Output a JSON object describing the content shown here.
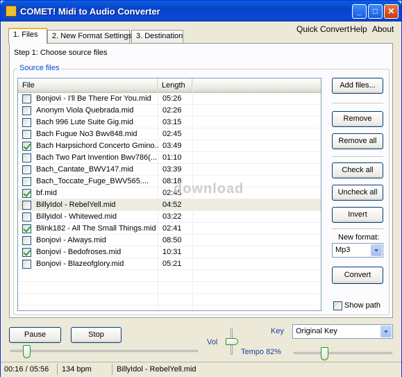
{
  "window": {
    "title": "COMET! Midi to Audio Converter"
  },
  "tabs": [
    {
      "label": "1. Files"
    },
    {
      "label": "2. New Format Settings"
    },
    {
      "label": "3. Destination"
    }
  ],
  "top_links": {
    "quick_convert": "Quick Convert",
    "help": "Help",
    "about": "About"
  },
  "step_text": "Step 1: Choose source files",
  "group_label": "Source files",
  "list": {
    "columns": [
      "File",
      "Length"
    ],
    "rows": [
      {
        "name": "Bonjovi - I'll Be There For You.mid",
        "length": "05:26",
        "checked": false,
        "selected": false
      },
      {
        "name": "Anonym Viola Quebrada.mid",
        "length": "02:26",
        "checked": false,
        "selected": false
      },
      {
        "name": "Bach 996 Lute Suite Gig.mid",
        "length": "03:15",
        "checked": false,
        "selected": false
      },
      {
        "name": "Bach Fugue No3 Bwv848.mid",
        "length": "02:45",
        "checked": false,
        "selected": false
      },
      {
        "name": "Bach Harpsichord Concerto Gmino...",
        "length": "03:49",
        "checked": true,
        "selected": false
      },
      {
        "name": "Bach Two Part Invention Bwv786(...",
        "length": "01:10",
        "checked": false,
        "selected": false
      },
      {
        "name": "Bach_Cantate_BWV147.mid",
        "length": "03:39",
        "checked": false,
        "selected": false
      },
      {
        "name": "Bach_Toccate_Fuge_BWV565....",
        "length": "08:18",
        "checked": false,
        "selected": false
      },
      {
        "name": "bf.mid",
        "length": "02:45",
        "checked": true,
        "selected": false
      },
      {
        "name": "BillyIdol - RebelYell.mid",
        "length": "04:52",
        "checked": false,
        "selected": true
      },
      {
        "name": "Billyidol - Whitewed.mid",
        "length": "03:22",
        "checked": false,
        "selected": false
      },
      {
        "name": "Blink182 - All The Small Things.mid",
        "length": "02:41",
        "checked": true,
        "selected": false
      },
      {
        "name": "Bonjovi - Always.mid",
        "length": "08:50",
        "checked": false,
        "selected": false
      },
      {
        "name": "Bonjovi - Bedofroses.mid",
        "length": "10:31",
        "checked": true,
        "selected": false
      },
      {
        "name": "Bonjovi - Blazeofglory.mid",
        "length": "05:21",
        "checked": false,
        "selected": false
      }
    ]
  },
  "buttons": {
    "add_files": "Add files...",
    "remove": "Remove",
    "remove_all": "Remove all",
    "check_all": "Check all",
    "uncheck_all": "Uncheck all",
    "invert": "Invert",
    "convert": "Convert",
    "pause": "Pause",
    "stop": "Stop"
  },
  "new_format": {
    "label": "New format:",
    "value": "Mp3"
  },
  "show_path": {
    "label": "Show path",
    "checked": false
  },
  "player": {
    "vol_label": "Vol",
    "key_label": "Key",
    "key_value": "Original Key",
    "tempo_label": "Tempo 82%",
    "position_fraction": 0.07,
    "volume_fraction": 0.0,
    "tempo_fraction": 0.3
  },
  "status": {
    "time": "00:16 / 05:56",
    "bpm": "134 bpm",
    "file": "BillyIdol - RebelYell.mid"
  },
  "watermark": "download"
}
